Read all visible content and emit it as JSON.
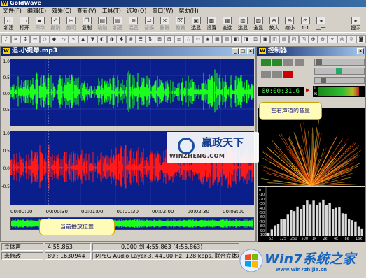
{
  "app": {
    "title": "GoldWave",
    "logo_letter": "W"
  },
  "menu": [
    "文件(F)",
    "编辑(E)",
    "效果(C)",
    "查看(V)",
    "工具(T)",
    "选项(O)",
    "窗口(W)",
    "帮助(H)"
  ],
  "toolbar": {
    "buttons": [
      {
        "label": "新建",
        "icon": "new-icon",
        "glyph": "▫"
      },
      {
        "label": "打开",
        "icon": "open-icon",
        "glyph": "▭"
      },
      {
        "label": "保存",
        "icon": "save-icon",
        "glyph": "▪"
      },
      {
        "label": "撤销",
        "icon": "undo-icon",
        "glyph": "↶"
      },
      {
        "label": "剪切",
        "icon": "cut-icon",
        "glyph": "✂"
      },
      {
        "label": "复制",
        "icon": "copy-icon",
        "glyph": "❐"
      },
      {
        "label": "粘贴",
        "icon": "paste-icon",
        "glyph": "▤"
      },
      {
        "label": "新建",
        "icon": "paste-new-icon",
        "glyph": "▤"
      },
      {
        "label": "混音",
        "icon": "mix-icon",
        "glyph": "≋"
      },
      {
        "label": "替换",
        "icon": "replace-icon",
        "glyph": "⇄"
      },
      {
        "label": "删除",
        "icon": "delete-icon",
        "glyph": "✕"
      },
      {
        "label": "剪裁",
        "icon": "trim-icon",
        "glyph": "⌧"
      },
      {
        "label": "选显",
        "icon": "select-view-icon",
        "glyph": "▣"
      },
      {
        "label": "设置",
        "icon": "set-icon",
        "glyph": "▩"
      },
      {
        "label": "全选",
        "icon": "select-all-icon",
        "glyph": "▦"
      },
      {
        "label": "选显",
        "icon": "select-shown-icon",
        "glyph": "▥"
      },
      {
        "label": "全显",
        "icon": "show-all-icon",
        "glyph": "▧"
      },
      {
        "label": "放大",
        "icon": "zoom-in-icon",
        "glyph": "⊕"
      },
      {
        "label": "缩小",
        "icon": "zoom-out-icon",
        "glyph": "⊖"
      },
      {
        "label": "1:1",
        "icon": "zoom-1to1-icon",
        "glyph": "⊙"
      },
      {
        "label": "上一",
        "icon": "previous-icon",
        "glyph": "◂"
      },
      {
        "label": "提示",
        "icon": "cue-icon",
        "glyph": "▸"
      }
    ]
  },
  "toolbar2": {
    "glyphs": [
      "♪",
      "≈",
      "↕",
      "↔",
      "◇",
      "◆",
      "∿",
      "⌁",
      "▲",
      "▼",
      "◐",
      "◑",
      "✱",
      "⊗",
      "☰",
      "⇅",
      "⊞",
      "⊟",
      "≡",
      "∴",
      "⋯",
      "◈",
      "▦",
      "▥",
      "◧",
      "◨",
      "⊡",
      "▣",
      "◫",
      "▤",
      "◰",
      "◳",
      "⊕",
      "⊖",
      "⌖",
      "◎",
      "☼",
      "◙"
    ]
  },
  "wave_window": {
    "title": "追.小提琴.mp3",
    "top_channel": {
      "color": "#1cff1c",
      "labels": [
        "1.0",
        "0.5",
        "0.0",
        "-0.5"
      ]
    },
    "bottom_channel": {
      "color": "#ff1a1a",
      "labels": [
        "1.0",
        "0.5",
        "0.0",
        "-0.5"
      ]
    },
    "ruler": [
      "00:00:00",
      "00:00:30",
      "00:01:00",
      "00:01:30",
      "00:02:00",
      "00:02:30",
      "00:03:00"
    ],
    "background": "#0b1f8c"
  },
  "controller": {
    "title": "控制器",
    "time": "00:00:31.6",
    "channel_labels": [
      "L",
      "R"
    ]
  },
  "spectrum": {
    "axis": [
      "0",
      "-10",
      "-20",
      "-30",
      "-40",
      "-50",
      "-60",
      "-70",
      "-80",
      "-90",
      "-100"
    ],
    "bands": [
      "62",
      "125",
      "250",
      "500",
      "1k",
      "2k",
      "4k",
      "8k",
      "16k"
    ]
  },
  "callouts": {
    "volume": "左右声道的音量",
    "position": "当前播放位置"
  },
  "status": {
    "channel_mode": "立体声",
    "duration": "4:55.863",
    "selection": "0.000 到 4:55.863 (4:55.863)",
    "modified": "未修改",
    "counter": "89 : 1630944",
    "format": "MPEG Audio Layer-3, 44100 Hz, 128 kbps, 联合立体声"
  },
  "watermarks": {
    "winzheng_title": "赢政天下",
    "winzheng_url": "WINZHENG.COM",
    "win7_title": "Win7系统之家",
    "win7_url": "www.win7zhijia.cn"
  },
  "colors": {
    "accent": "#0a246a",
    "titlebar_end": "#a6caf0",
    "spectrum_bar": "#d9d9d9",
    "time_text": "#4dff4d"
  }
}
